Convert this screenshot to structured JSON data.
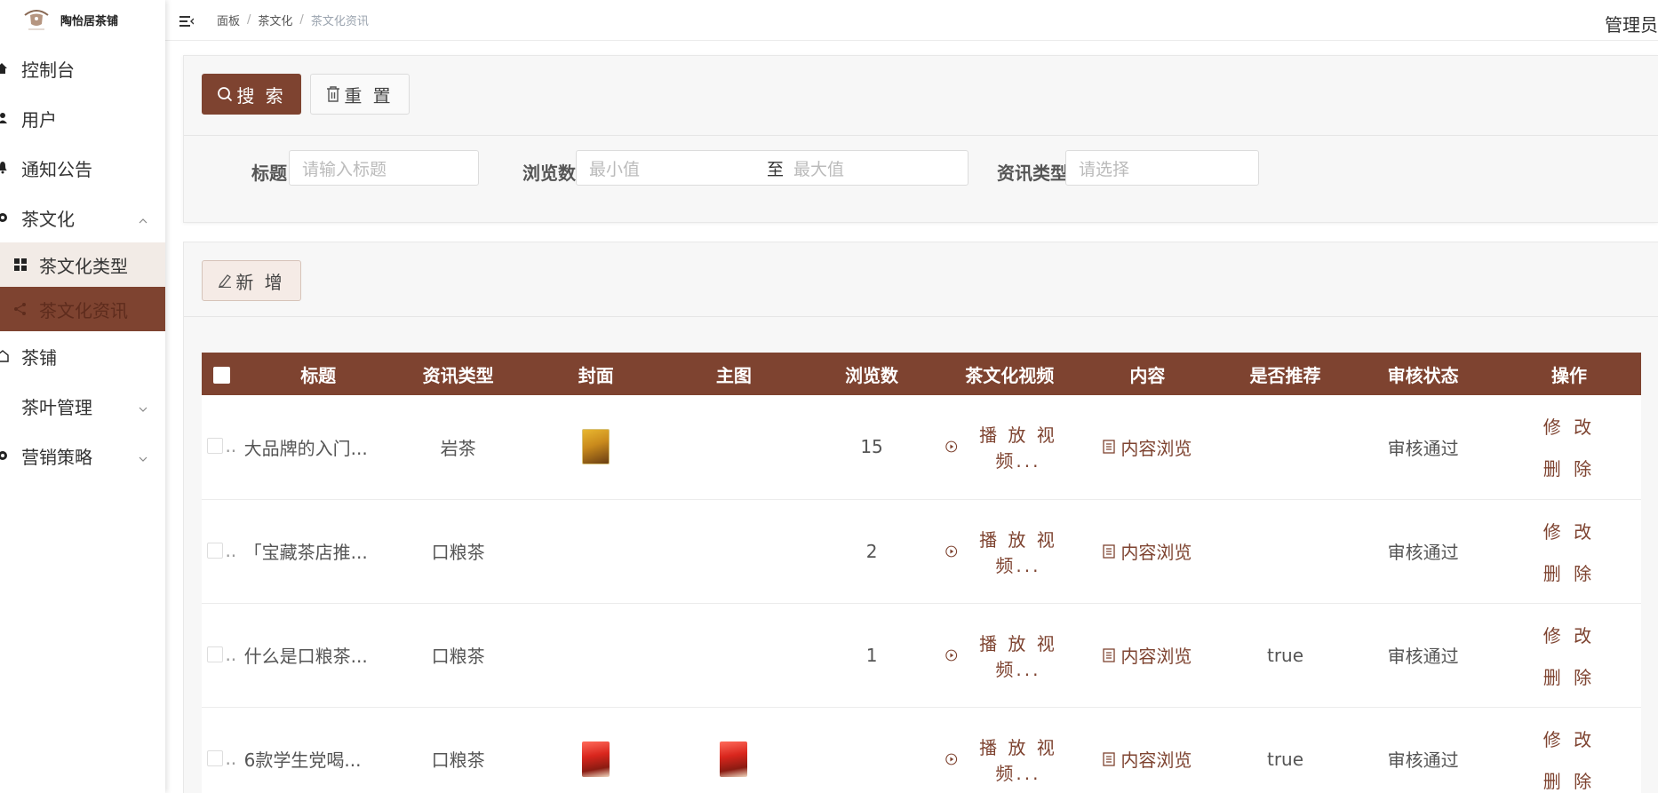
{
  "app": {
    "name": "陶怡居茶铺",
    "admin": "管理员"
  },
  "sidebar": {
    "items": [
      {
        "label": "控制台",
        "icon": "home-icon"
      },
      {
        "label": "用户",
        "icon": "user-icon"
      },
      {
        "label": "通知公告",
        "icon": "bell-icon"
      },
      {
        "label": "茶文化",
        "icon": "chrome-icon",
        "expanded": true,
        "children": [
          {
            "label": "茶文化类型",
            "icon": "grid-icon"
          },
          {
            "label": "茶文化资讯",
            "icon": "share-icon"
          }
        ]
      },
      {
        "label": "茶铺",
        "icon": "house-outline-icon"
      },
      {
        "label": "茶叶管理",
        "icon": "chevron-down-icon"
      },
      {
        "label": "营销策略",
        "icon": "chrome-icon"
      }
    ]
  },
  "breadcrumb": [
    "面板",
    "茶文化",
    "茶文化资讯"
  ],
  "search": {
    "search_label": "搜 索",
    "reset_label": "重 置",
    "title_label": "标题",
    "title_placeholder": "请输入标题",
    "views_label": "浏览数",
    "min_placeholder": "最小值",
    "range_sep": "至",
    "max_placeholder": "最大值",
    "type_label": "资讯类型",
    "type_placeholder": "请选择"
  },
  "toolbar": {
    "add_label": "新 增"
  },
  "table": {
    "columns": [
      "标题",
      "资讯类型",
      "封面",
      "主图",
      "浏览数",
      "茶文化视频",
      "内容",
      "是否推荐",
      "审核状态",
      "操作"
    ],
    "video_label": "播 放 视 频...",
    "content_label": "内容浏览",
    "edit_label": "修 改",
    "delete_label": "删 除",
    "rows": [
      {
        "title": "大品牌的入门...",
        "type": "岩茶",
        "cover": "yellow",
        "main": "",
        "views": "15",
        "recommend": "",
        "status": "审核通过"
      },
      {
        "title": "「宝藏茶店推...",
        "type": "口粮茶",
        "cover": "",
        "main": "",
        "views": "2",
        "recommend": "",
        "status": "审核通过"
      },
      {
        "title": "什么是口粮茶...",
        "type": "口粮茶",
        "cover": "",
        "main": "",
        "views": "1",
        "recommend": "true",
        "status": "审核通过"
      },
      {
        "title": "6款学生党喝...",
        "type": "口粮茶",
        "cover": "red",
        "main": "red",
        "views": "",
        "recommend": "true",
        "status": "审核通过"
      }
    ]
  },
  "colors": {
    "brand": "#7e4330",
    "brand_light": "#f2ebe6"
  }
}
